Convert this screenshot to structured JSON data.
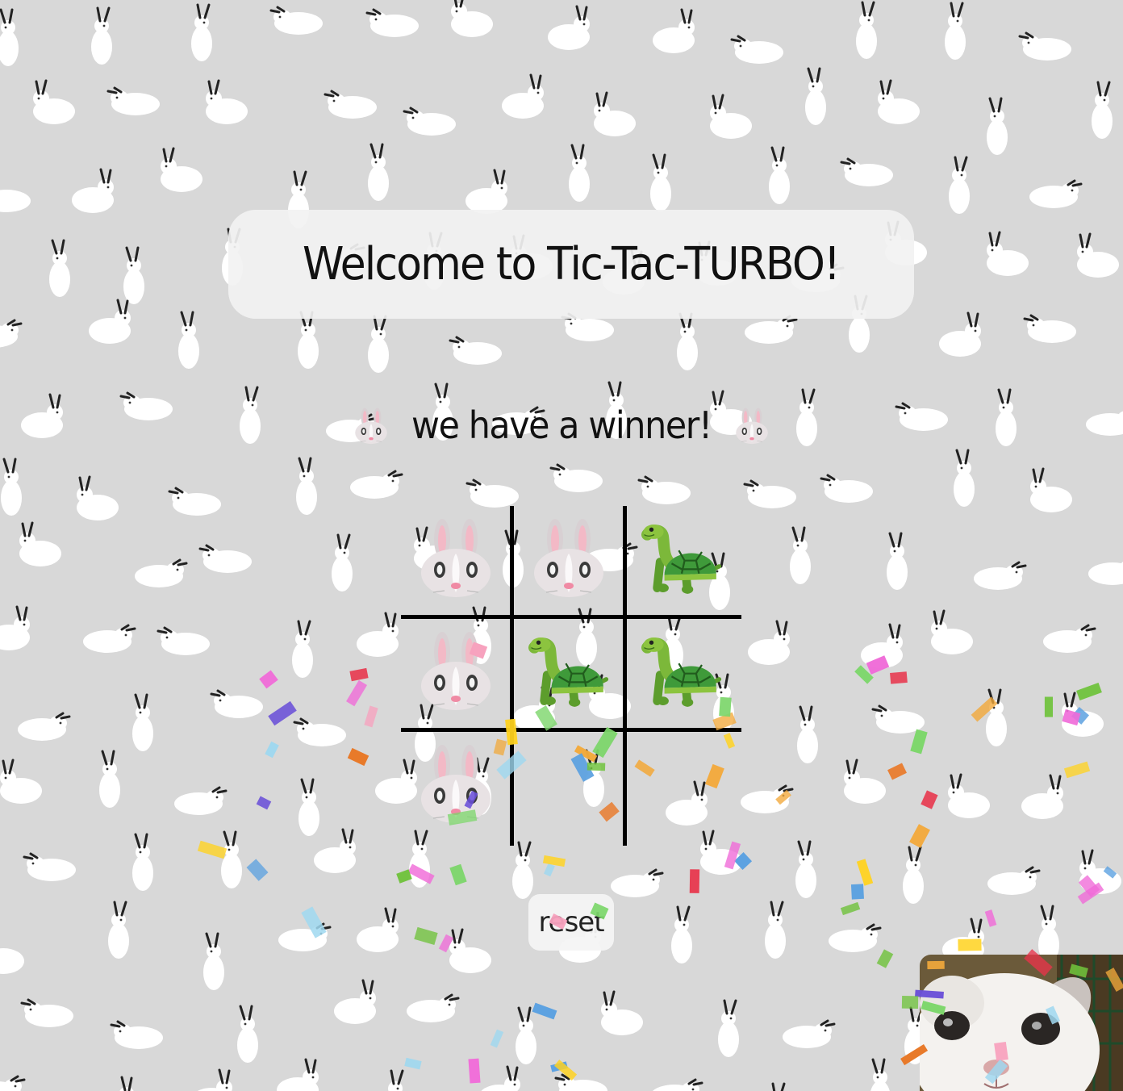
{
  "title": "Welcome to Tic-Tac-TURBO!",
  "status": {
    "text": "we have a winner!",
    "left_icon": "rabbit-face-icon",
    "right_icon": "rabbit-face-icon"
  },
  "board": {
    "cells": [
      "rabbit",
      "rabbit",
      "turtle",
      "rabbit",
      "turtle",
      "turtle",
      "rabbit",
      "",
      ""
    ],
    "winner": "rabbit"
  },
  "reset_label": "reset",
  "colors": {
    "background": "#d8d8d8",
    "grid_line": "#000000",
    "turtle_shell": "#3f9a3a",
    "rabbit_fur": "#e8e2e4",
    "rabbit_ear_inner": "#f3b9c6"
  },
  "decorations": {
    "background_pattern": "white-rabbit-pattern",
    "corner_photo": "pet-rabbit-photo",
    "effect": "confetti"
  }
}
